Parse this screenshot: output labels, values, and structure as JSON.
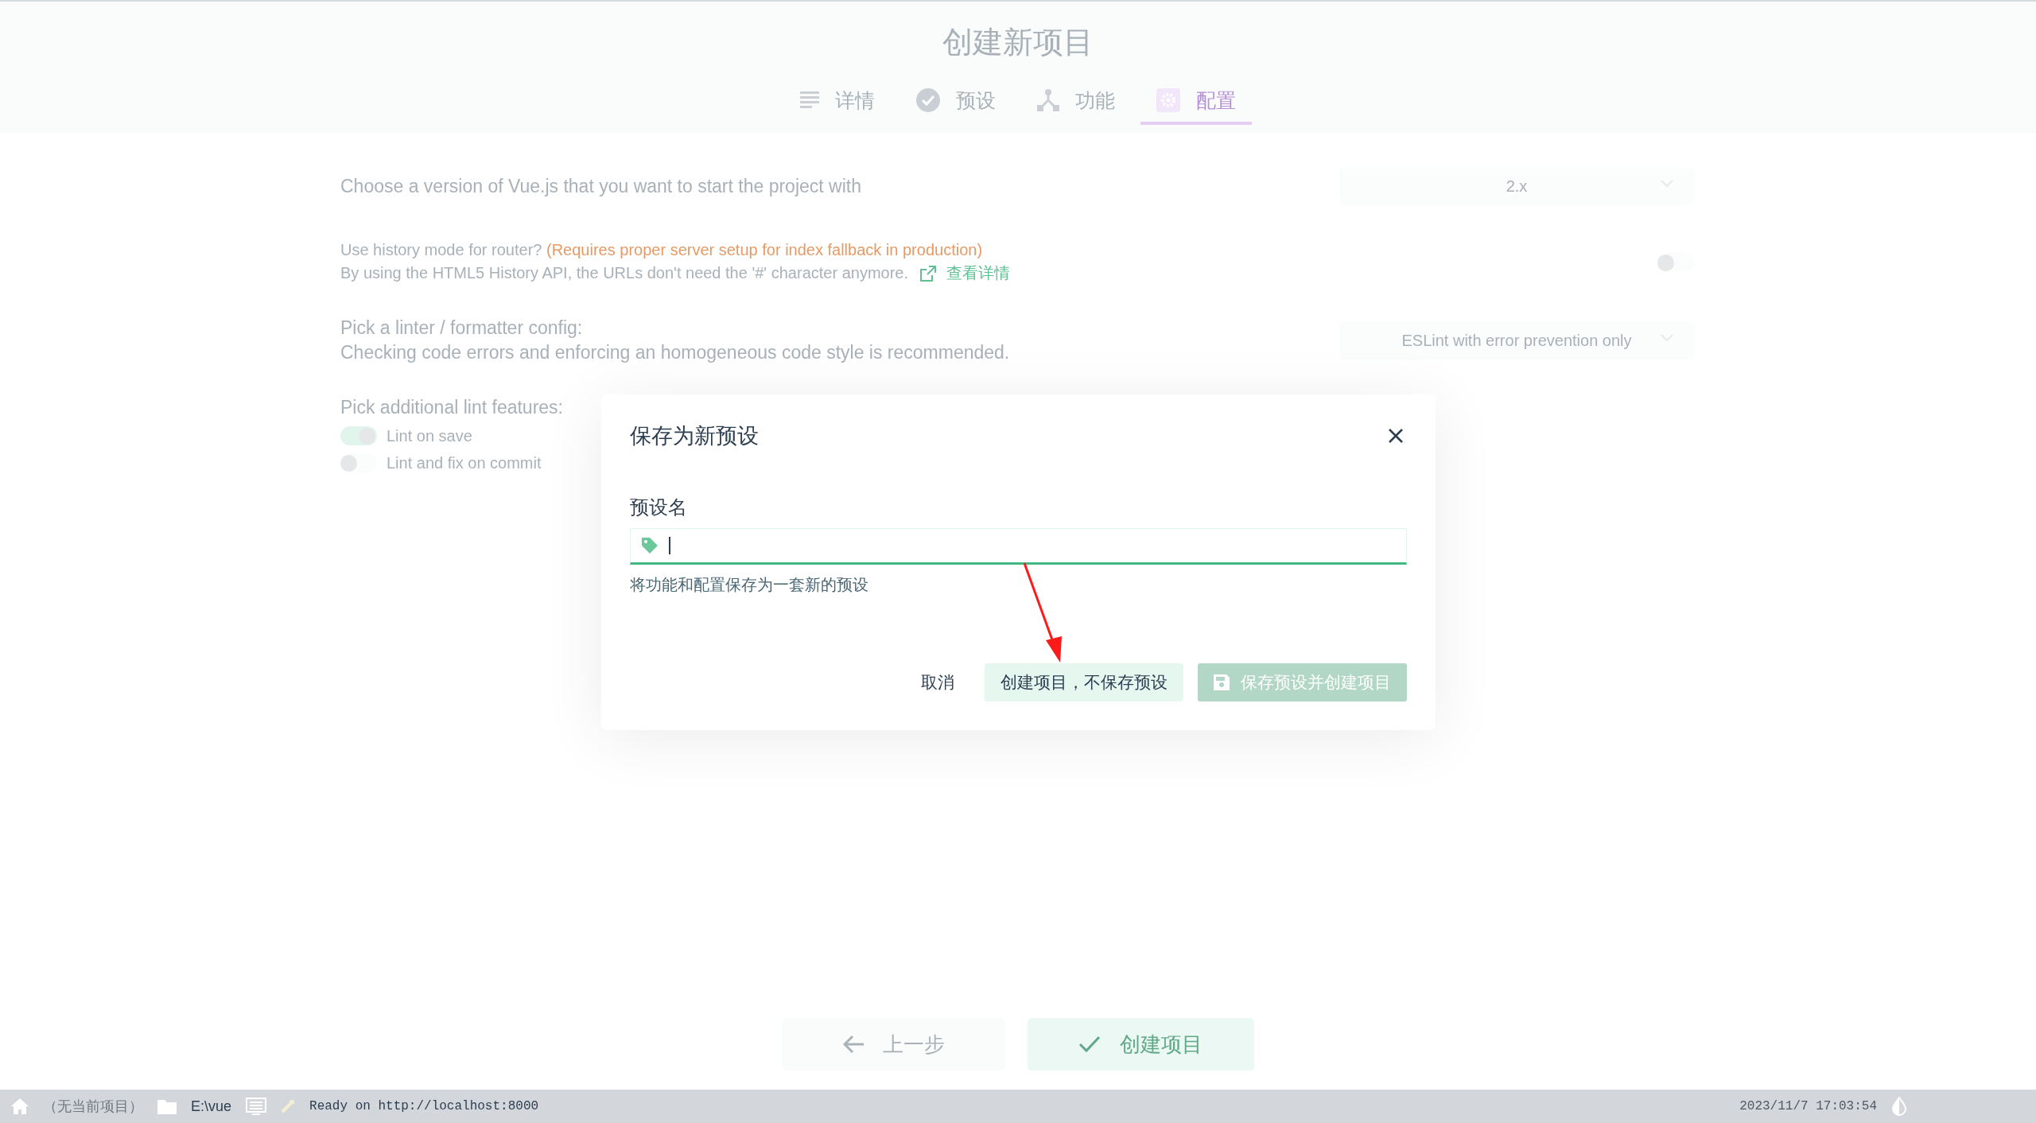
{
  "header": {
    "title": "创建新项目"
  },
  "tabs": [
    {
      "label": "详情",
      "selected": false
    },
    {
      "label": "预设",
      "selected": false
    },
    {
      "label": "功能",
      "selected": false
    },
    {
      "label": "配置",
      "selected": true
    }
  ],
  "settings": [
    {
      "kind": "select",
      "title": "Choose a version of Vue.js that you want to start the project with",
      "value": "2.x"
    },
    {
      "kind": "toggle",
      "title": "Use history mode for router?",
      "warning": "(Requires proper server setup for index fallback in production)",
      "description": "By using the HTML5 History API, the URLs don't need the '#' character anymore.",
      "link": "查看详情",
      "on": false
    },
    {
      "kind": "select",
      "title": "Pick a linter / formatter config:",
      "description": "Checking code errors and enforcing an homogeneous code style is recommended.",
      "value": "ESLint with error prevention only"
    },
    {
      "kind": "checks",
      "title": "Pick additional lint features:",
      "options": [
        {
          "label": "Lint on save",
          "on": true
        },
        {
          "label": "Lint and fix on commit",
          "on": false
        }
      ]
    }
  ],
  "actions": [
    {
      "label": "上一步",
      "kind": "back"
    },
    {
      "label": "创建项目",
      "kind": "create"
    }
  ],
  "dialog": {
    "title": "保存为新预设",
    "field_label": "预设名",
    "hint": "将功能和配置保存为一套新的预设",
    "buttons": [
      {
        "label": "取消",
        "kind": "flat",
        "disabled": false
      },
      {
        "label": "创建项目，不保存预设",
        "kind": "secondary",
        "disabled": false
      },
      {
        "label": "保存预设并创建项目",
        "kind": "primary",
        "disabled": true
      }
    ]
  },
  "status_bar": {
    "project": "（无当前项目）",
    "folder": "E:\\vue",
    "log": "Ready on http://localhost:8000",
    "time": "2023/11/7 17:03:54"
  }
}
